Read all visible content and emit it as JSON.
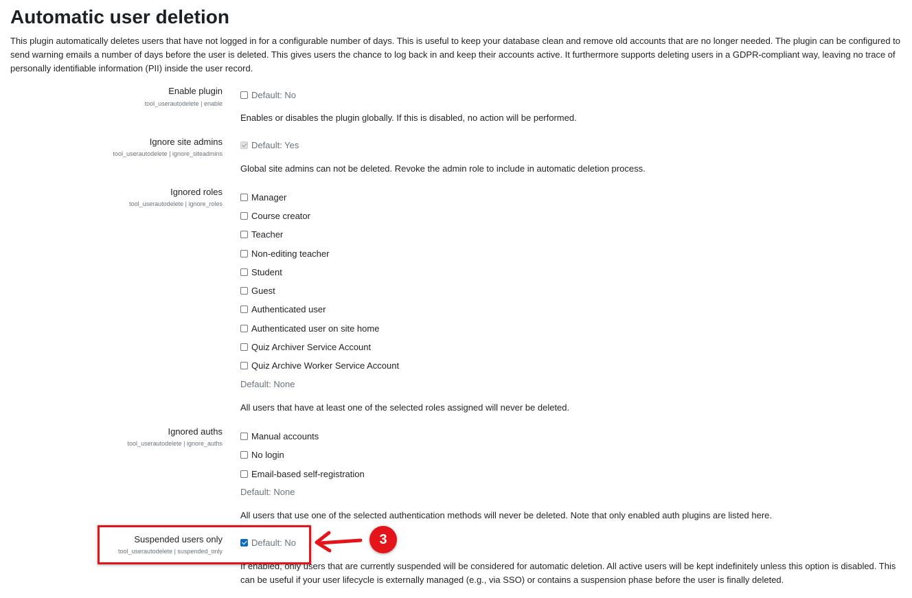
{
  "page": {
    "title": "Automatic user deletion",
    "intro": "This plugin automatically deletes users that have not logged in for a configurable number of days. This is useful to keep your database clean and remove old accounts that are no longer needed. The plugin can be configured to send warning emails a number of days before the user is deleted. This gives users the chance to log back in and keep their accounts active. It furthermore supports deleting users in a GDPR-compliant way, leaving no trace of personally identifiable information (PII) inside the user record."
  },
  "settings": {
    "enable": {
      "label": "Enable plugin",
      "key": "tool_userautodelete | enable",
      "checkbox_label": "Default: No",
      "checked": false,
      "description": "Enables or disables the plugin globally. If this is disabled, no action will be performed."
    },
    "ignore_siteadmins": {
      "label": "Ignore site admins",
      "key": "tool_userautodelete | ignore_siteadmins",
      "checkbox_label": "Default: Yes",
      "checked": true,
      "disabled": true,
      "description": "Global site admins can not be deleted. Revoke the admin role to include in automatic deletion process."
    },
    "ignore_roles": {
      "label": "Ignored roles",
      "key": "tool_userautodelete | ignore_roles",
      "options": [
        "Manager",
        "Course creator",
        "Teacher",
        "Non-editing teacher",
        "Student",
        "Guest",
        "Authenticated user",
        "Authenticated user on site home",
        "Quiz Archiver Service Account",
        "Quiz Archive Worker Service Account"
      ],
      "default": "Default: None",
      "description": "All users that have at least one of the selected roles assigned will never be deleted."
    },
    "ignore_auths": {
      "label": "Ignored auths",
      "key": "tool_userautodelete | ignore_auths",
      "options": [
        "Manual accounts",
        "No login",
        "Email-based self-registration"
      ],
      "default": "Default: None",
      "description": "All users that use one of the selected authentication methods will never be deleted. Note that only enabled auth plugins are listed here."
    },
    "suspended_only": {
      "label": "Suspended users only",
      "key": "tool_userautodelete | suspended_only",
      "checkbox_label": "Default: No",
      "checked": true,
      "description": "If enabled, only users that are currently suspended will be considered for automatic deletion. All active users will be kept indefinitely unless this option is disabled. This can be useful if your user lifecycle is externally managed (e.g., via SSO) or contains a suspension phase before the user is finally deleted."
    }
  },
  "annotation": {
    "step_number": "3",
    "color": "#e3151a"
  },
  "colors": {
    "text": "#1d2125",
    "muted": "#6a737b",
    "checkbox_accent": "#0f6cbf"
  }
}
